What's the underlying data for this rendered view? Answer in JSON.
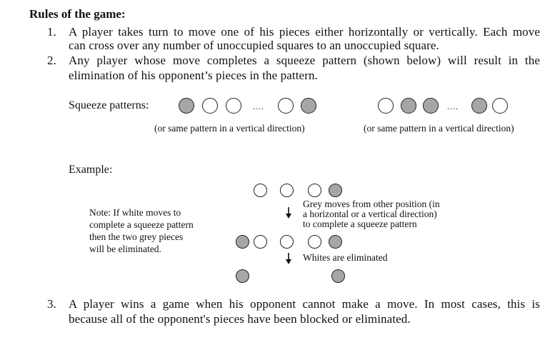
{
  "title": "Rules of the game:",
  "rules": [
    {
      "number": "1.",
      "lines": [
        "A player takes turn to move one of his pieces either horizontally or vertically. Each move",
        "can cross over any number of unoccupied squares to an unoccupied square."
      ]
    },
    {
      "number": "2.",
      "lines": [
        "Any player whose move completes a squeeze pattern (shown below) will result in the",
        "elimination of his opponent’s pieces in the pattern."
      ]
    },
    {
      "number": "3.",
      "lines": [
        "A player wins a game when his opponent cannot make a move. In most cases, this is",
        "because all of the opponent's pieces have been blocked or eliminated."
      ]
    }
  ],
  "squeeze": {
    "label": "Squeeze patterns:",
    "ellipsis": "....",
    "caption_left": "(or same pattern in a vertical direction)",
    "caption_right": "(or same pattern in a vertical direction)",
    "pattern_left": [
      "grey",
      "white",
      "white",
      "white",
      "grey"
    ],
    "pattern_right": [
      "white",
      "grey",
      "grey",
      "grey",
      "white"
    ]
  },
  "example": {
    "label": "Example:",
    "note_lines": [
      "Note: If white moves to",
      "complete a squeeze pattern",
      "then the two grey pieces",
      "will be eliminated."
    ],
    "grey_moves_lines": [
      "Grey moves from other position (in",
      "a horizontal or a vertical direction)",
      "to complete a squeeze pattern"
    ],
    "whites_eliminated": "Whites are eliminated",
    "row1": [
      "white",
      "white",
      "white",
      "grey"
    ],
    "row2": [
      "grey",
      "white",
      "white",
      "white",
      "grey"
    ],
    "row3": [
      "grey",
      "grey"
    ]
  },
  "colors": {
    "piece_grey": "#a6a6a6",
    "piece_white": "#ffffff",
    "outline": "#222222",
    "text": "#111111"
  }
}
